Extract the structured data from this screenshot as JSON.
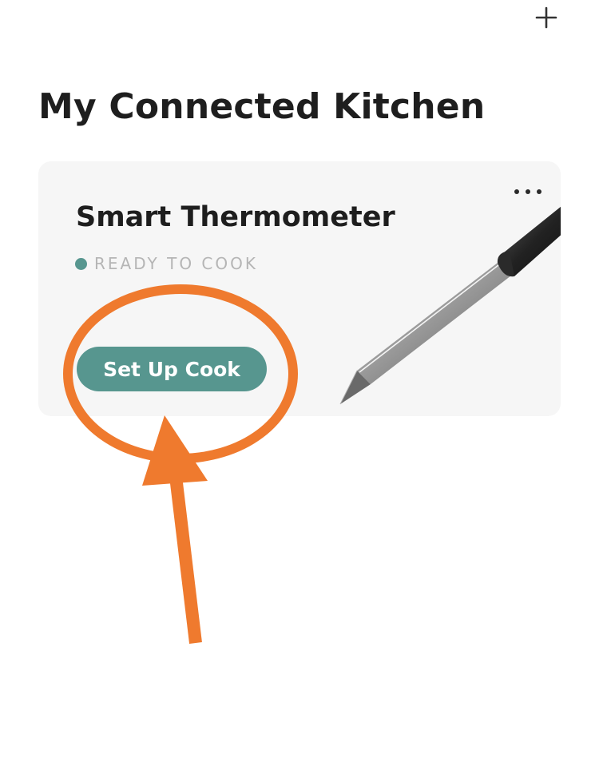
{
  "header": {
    "add_icon": "plus-icon"
  },
  "page": {
    "title": "My Connected Kitchen"
  },
  "device_card": {
    "name": "Smart Thermometer",
    "status": "READY TO COOK",
    "status_color": "#57968f",
    "button_label": "Set Up Cook",
    "button_color": "#57968f",
    "more_icon": "ellipsis-icon",
    "image": "thermometer-probe"
  },
  "annotation": {
    "color": "#ef7a2e",
    "shapes": [
      "ellipse-highlight",
      "arrow-up"
    ]
  }
}
